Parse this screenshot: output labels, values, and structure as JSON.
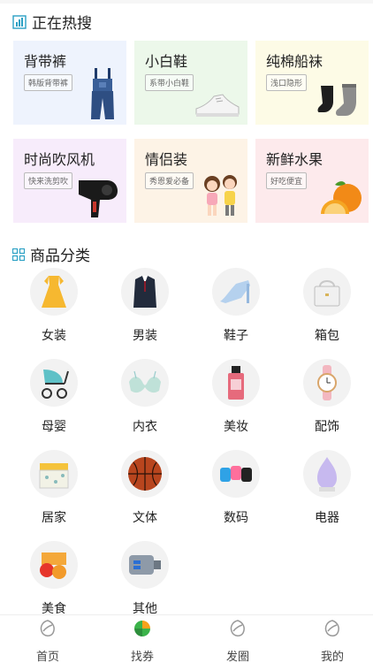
{
  "hot": {
    "title": "正在热搜",
    "items": [
      {
        "name": "背带裤",
        "tag": "韩版背带裤",
        "bg": "#eef3fd",
        "icon": "overalls-icon"
      },
      {
        "name": "小白鞋",
        "tag": "系带小白鞋",
        "bg": "#ecf8ea",
        "icon": "white-sneaker-icon"
      },
      {
        "name": "纯棉船袜",
        "tag": "浅口隐形",
        "bg": "#fdfbe6",
        "icon": "socks-icon"
      },
      {
        "name": "时尚吹风机",
        "tag": "快来洗剪吹",
        "bg": "#f7ecfb",
        "icon": "hair-dryer-icon"
      },
      {
        "name": "情侣装",
        "tag": "秀恩爱必备",
        "bg": "#fdf3e6",
        "icon": "couple-icon"
      },
      {
        "name": "新鲜水果",
        "tag": "好吃便宜",
        "bg": "#fdeaec",
        "icon": "orange-icon"
      }
    ]
  },
  "categories": {
    "title": "商品分类",
    "items": [
      {
        "label": "女装",
        "icon": "dress-icon"
      },
      {
        "label": "男装",
        "icon": "suit-icon"
      },
      {
        "label": "鞋子",
        "icon": "high-heel-icon"
      },
      {
        "label": "箱包",
        "icon": "handbag-icon"
      },
      {
        "label": "母婴",
        "icon": "stroller-icon"
      },
      {
        "label": "内衣",
        "icon": "bra-icon"
      },
      {
        "label": "美妆",
        "icon": "perfume-icon"
      },
      {
        "label": "配饰",
        "icon": "watch-icon"
      },
      {
        "label": "居家",
        "icon": "storage-box-icon"
      },
      {
        "label": "文体",
        "icon": "basketball-icon"
      },
      {
        "label": "数码",
        "icon": "earbuds-case-icon"
      },
      {
        "label": "电器",
        "icon": "humidifier-icon"
      },
      {
        "label": "美食",
        "icon": "snacks-icon"
      },
      {
        "label": "其他",
        "icon": "car-charger-icon"
      }
    ]
  },
  "tabbar": {
    "items": [
      {
        "label": "首页",
        "icon": "home-leaf-icon",
        "active": false
      },
      {
        "label": "找券",
        "icon": "coupon-leaf-icon",
        "active": true
      },
      {
        "label": "发圈",
        "icon": "share-leaf-icon",
        "active": false
      },
      {
        "label": "我的",
        "icon": "profile-leaf-icon",
        "active": false
      }
    ]
  },
  "colors": {
    "accent": "#2ba0c4",
    "active_tab_orange": "#f7a21b",
    "active_tab_green": "#3bb34a"
  }
}
